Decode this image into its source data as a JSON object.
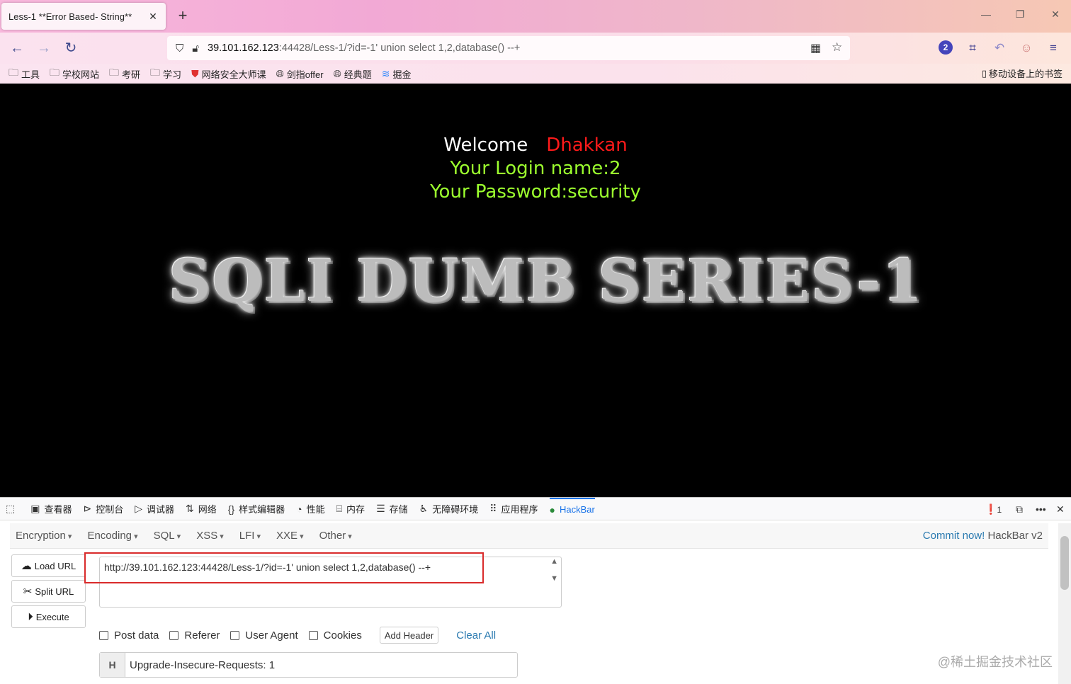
{
  "browser": {
    "tab_title": "Less-1 **Error Based- String**",
    "tab_close": "✕",
    "newtab": "+",
    "url_host": "39.101.162.123",
    "url_rest": ":44428/Less-1/?id=-1' union select 1,2,database() --+",
    "badge_count": "2",
    "bookmarks": [
      "工具",
      "学校网站",
      "考研",
      "学习",
      "网络安全大师课",
      "剑指offer",
      "经典题",
      "掘金"
    ],
    "mobile_bookmarks": "移动设备上的书签"
  },
  "page": {
    "welcome": "Welcome",
    "user": "Dhakkan",
    "login_line": "Your Login name:2",
    "password_line": "Your Password:security",
    "banner": "SQLI DUMB SERIES-1"
  },
  "devtools": {
    "tabs": [
      "查看器",
      "控制台",
      "调试器",
      "网络",
      "样式编辑器",
      "性能",
      "内存",
      "存储",
      "无障碍环境",
      "应用程序",
      "HackBar"
    ],
    "error_count": "1"
  },
  "hackbar": {
    "menus": [
      "Encryption",
      "Encoding",
      "SQL",
      "XSS",
      "LFI",
      "XXE",
      "Other"
    ],
    "commit_link": "Commit now!",
    "version": "HackBar v2",
    "buttons": {
      "load": "Load URL",
      "split": "Split URL",
      "execute": "Execute"
    },
    "url_value": "http://39.101.162.123:44428/Less-1/?id=-1' union select 1,2,database() --+",
    "checkboxes": [
      "Post data",
      "Referer",
      "User Agent",
      "Cookies"
    ],
    "add_header": "Add Header",
    "clear_all": "Clear All",
    "header_prefix": "H",
    "header_value": "Upgrade-Insecure-Requests: 1"
  },
  "watermark": "@稀土掘金技术社区",
  "colors": {
    "accent": "#1a73e8",
    "welcome_user": "#ff1a1a",
    "green_text": "#9cff2e",
    "highlight_box": "#d92b2b"
  }
}
